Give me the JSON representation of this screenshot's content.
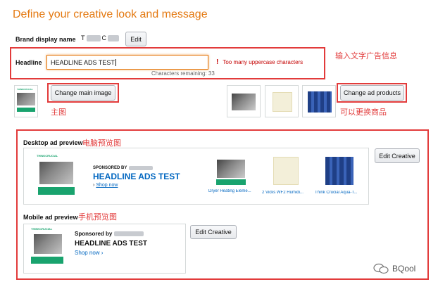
{
  "page": {
    "title": "Define your creative look and message"
  },
  "brand": {
    "label": "Brand display name",
    "value_chars": [
      "T",
      "C"
    ],
    "edit_label": "Edit"
  },
  "headline": {
    "label": "Headline",
    "value": "HEADLINE ADS TEST",
    "error_icon": "!",
    "error": "Too many uppercase characters",
    "remaining": "Characters remaining: 33"
  },
  "annotations": {
    "headline_note": "输入文字广告信息",
    "main_image_note": "主图",
    "products_note": "可以更换商品",
    "desktop_note": "电脑预览图",
    "mobile_note": "手机预览图"
  },
  "main_image": {
    "button": "Change main image",
    "brand_tag": "THINKCRUCIAL"
  },
  "products": {
    "button": "Change ad products"
  },
  "desktop_preview": {
    "label": "Desktop ad preview",
    "edit_button": "Edit Creative",
    "sponsored_by": "SPONSORED BY",
    "headline": "HEADLINE ADS TEST",
    "shop_now": "Shop now",
    "brand_tag": "THINKCRUCIAL",
    "items": [
      {
        "title": "Dryer Heating Eleme...",
        "icon": "heating-element-image"
      },
      {
        "title": "2 Vicks WF2 Humidi...",
        "icon": "humidifier-filter-image"
      },
      {
        "title": "Think Crucial Aqua-T...",
        "icon": "blue-filter-image"
      }
    ]
  },
  "mobile_preview": {
    "label": "Mobile ad preview",
    "edit_button": "Edit Creative",
    "sponsored_by": "Sponsored by",
    "headline": "HEADLINE ADS TEST",
    "shop_now": "Shop now ›",
    "brand_tag": "THINKCRUCIAL"
  },
  "watermark": {
    "text": "BQool"
  },
  "colors": {
    "title": "#e47911",
    "annotation_red": "#e23b3b",
    "link_blue": "#0066c0",
    "error_red": "#c40000",
    "product_green": "#19a36e",
    "filter_blue": "#2d4f9e"
  }
}
